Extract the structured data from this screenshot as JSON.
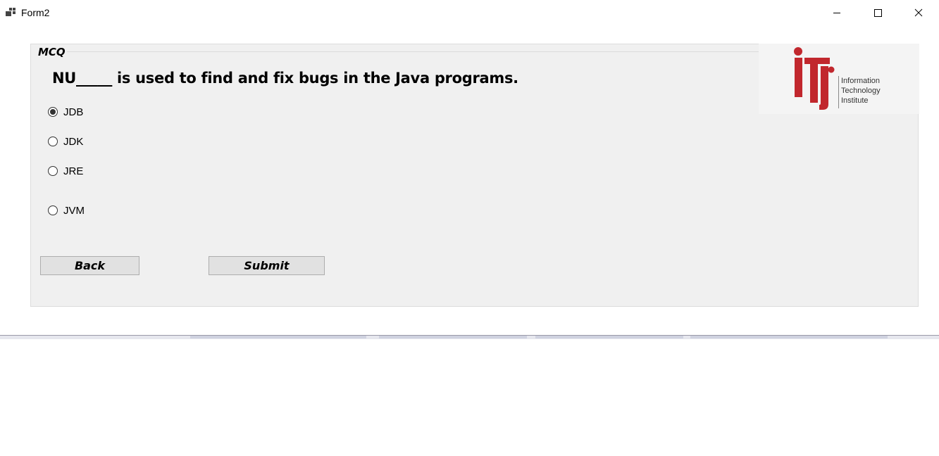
{
  "window": {
    "title": "Form2"
  },
  "group": {
    "legend": "MCQ",
    "question": "NU_____ is used to find and fix bugs in the Java programs."
  },
  "options": [
    {
      "label": "JDB",
      "checked": true
    },
    {
      "label": "JDK",
      "checked": false
    },
    {
      "label": "JRE",
      "checked": false
    },
    {
      "label": "JVM",
      "checked": false
    }
  ],
  "buttons": {
    "back_label": "Back",
    "submit_label": "Submit"
  },
  "logo": {
    "line1": "Information",
    "line2": "Technology",
    "line3": "Institute",
    "brand_color": "#c1272d"
  }
}
